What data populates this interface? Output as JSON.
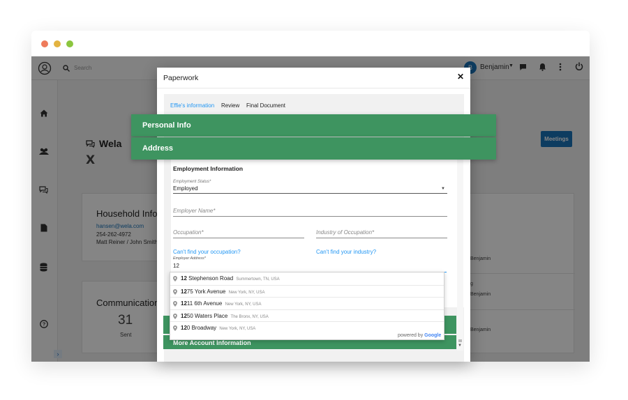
{
  "window": {
    "dots": [
      "#ee7b5b",
      "#e3b341",
      "#8cc63f"
    ]
  },
  "topbar": {
    "search_placeholder": "Search",
    "user_initial": "B",
    "user_name": "Benjamin"
  },
  "background": {
    "title": "Wela",
    "meetings_label": "Meetings",
    "household": {
      "heading": "Household Info",
      "email": "hansen@wela.com",
      "phone": "254-262-4972",
      "members": "Matt Reiner / John Smith"
    },
    "communication": {
      "heading": "Communication",
      "count": "31",
      "count_label": "Sent"
    },
    "right_notes": [
      "Benjamin",
      "g",
      "Benjamin",
      "Benjamin"
    ]
  },
  "modal": {
    "title": "Paperwork",
    "tabs": [
      "Effie's information",
      "Review",
      "Final Document"
    ],
    "active_tab_color": "#2196f3",
    "sections": [
      "Personal Info",
      "Address"
    ],
    "employment": {
      "heading": "Employment Information",
      "status_label": "Employment Status*",
      "status_value": "Employed",
      "employer_name_placeholder": "Employer Name*",
      "occupation_placeholder": "Occupation*",
      "industry_placeholder": "Industry of Occupation*",
      "cant_find_occupation": "Can't find your occupation?",
      "cant_find_industry": "Can't find your industry?",
      "address_label": "Employer Address*",
      "address_value": "12"
    },
    "suggestions": [
      {
        "match": "12",
        "rest": " Stephenson Road",
        "sub": "Summertown, TN, USA"
      },
      {
        "match": "12",
        "rest": "75 York Avenue",
        "sub": "New York, NY, USA"
      },
      {
        "match": "12",
        "rest": "11 6th Avenue",
        "sub": "New York, NY, USA"
      },
      {
        "match": "12",
        "rest": "50 Waters Place",
        "sub": "The Bronx, NY, USA"
      },
      {
        "match": "12",
        "rest": "0 Broadway",
        "sub": "New York, NY, USA"
      }
    ],
    "powered_by": "powered by",
    "google": "Google",
    "more_account": "More Account Information",
    "brand_green": "#3e9460"
  }
}
